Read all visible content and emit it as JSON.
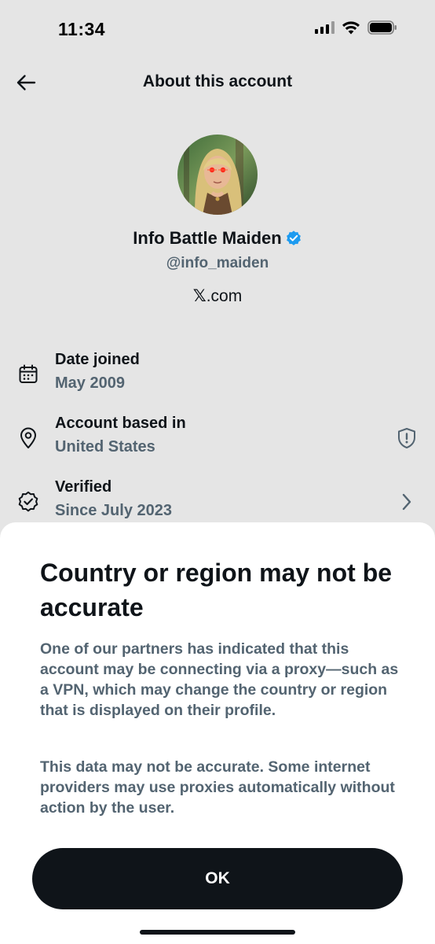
{
  "status_bar": {
    "time": "11:34",
    "icons": [
      "signal-icon",
      "wifi-icon",
      "battery-icon"
    ]
  },
  "header": {
    "back_icon": "arrow-left-icon",
    "title": "About this account"
  },
  "profile": {
    "display_name": "Info Battle Maiden",
    "verified_icon": "verified-badge-icon",
    "handle": "@info_maiden",
    "platform_logo": "𝕏",
    "platform_suffix": ".com"
  },
  "info_rows": [
    {
      "icon": "calendar-icon",
      "title": "Date joined",
      "value": "May 2009"
    },
    {
      "icon": "location-pin-icon",
      "title": "Account based in",
      "value": "United States",
      "action_icon": "shield-alert-icon"
    },
    {
      "icon": "verified-outline-icon",
      "title": "Verified",
      "value": "Since July 2023",
      "action_icon": "chevron-right-icon"
    }
  ],
  "sheet": {
    "title": "Country or region may not be accurate",
    "paragraph1": "One of our partners has indicated that this account may be connecting via a proxy—such as a VPN, which may change the country or region that is displayed on their profile.",
    "paragraph2": "This data may not be accurate. Some internet providers may use proxies automatically without action by the user.",
    "ok_label": "OK"
  },
  "colors": {
    "background": "#e5e5e5",
    "sheet": "#ffffff",
    "primary_text": "#0f1419",
    "secondary_text": "#536471",
    "verified_blue": "#1d9bf0",
    "button": "#0f1419"
  }
}
